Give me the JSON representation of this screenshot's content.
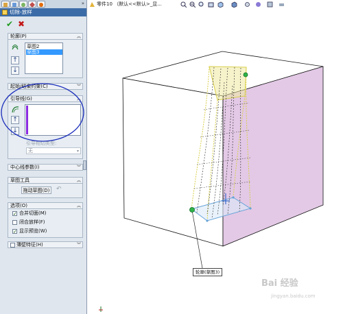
{
  "feature_manager": {
    "title": "切除-放样",
    "ok_label": "✔",
    "cancel_label": "✖"
  },
  "sections": {
    "profiles": {
      "header": "轮廓(P)",
      "items": [
        "草图2",
        "草图3"
      ],
      "selected_index": 1
    },
    "start_end_constraints": {
      "header": "起始/结束约束(C)"
    },
    "guide_curves": {
      "header": "引导线(G)",
      "guide_type_label": "引导相切类型:",
      "guide_type_value": "无"
    },
    "centerline": {
      "header": "中心线参数(I)"
    },
    "sketch_tools": {
      "header": "草图工具",
      "drag_sketch_button": "拖动草图(D)"
    },
    "options": {
      "header": "选项(O)",
      "checkboxes": [
        {
          "label": "合并切面(M)",
          "checked": true
        },
        {
          "label": "闭合放样(F)",
          "checked": false
        },
        {
          "label": "显示预览(W)",
          "checked": true
        }
      ]
    },
    "thin_feature": {
      "header": "薄壁特征(H)",
      "checked": false
    }
  },
  "viewport": {
    "document_title": "零件10 （默认<<默认>_显...",
    "profile_label": "轮廓(草图3)",
    "watermark": "Bai 经验",
    "watermark_url": "jingyan.baidu.com"
  },
  "colors": {
    "title_bar": "#3c6ca8",
    "cube_side_face": "#e3c9e6",
    "preview_lines": "#d8cf4a",
    "annotation_circle": "#1a2dbb",
    "selection": "#3399ff"
  },
  "icons": {
    "panel_tabs": [
      "feature-manager-icon",
      "property-manager-icon",
      "configuration-manager-icon",
      "dimxpert-icon",
      "display-manager-icon"
    ],
    "toolbar": [
      "zoom-to-fit-icon",
      "zoom-area-icon",
      "previous-view-icon",
      "section-view-icon",
      "view-orientation-icon",
      "display-style-icon",
      "hide-show-icon",
      "edit-appearance-icon",
      "scene-icon",
      "display-settings-icon"
    ]
  }
}
